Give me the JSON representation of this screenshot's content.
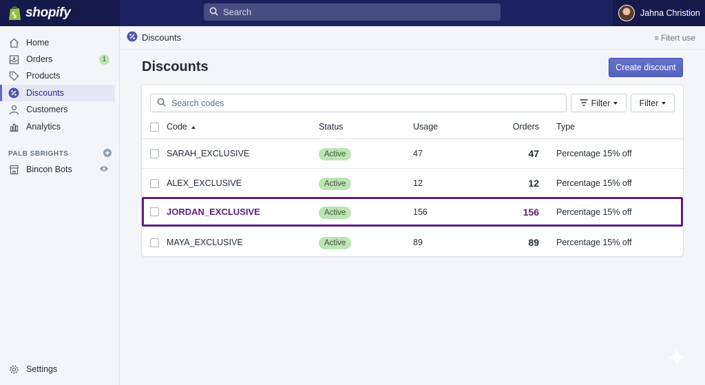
{
  "brand": {
    "name": "shopify"
  },
  "topbar": {
    "search_placeholder": "Search",
    "user_name": "Jahna Christion"
  },
  "sidebar": {
    "items": [
      {
        "label": "Home",
        "icon": "home-icon"
      },
      {
        "label": "Orders",
        "icon": "orders-icon",
        "badge": "1"
      },
      {
        "label": "Products",
        "icon": "tag-icon"
      },
      {
        "label": "Discounts",
        "icon": "discount-icon",
        "active": true
      },
      {
        "label": "Customers",
        "icon": "person-icon"
      },
      {
        "label": "Analytics",
        "icon": "chart-icon"
      }
    ],
    "section_title": "PALB SBRIGHTS",
    "channel": {
      "label": "Bincon Bots",
      "icon": "store-icon"
    },
    "settings_label": "Settings"
  },
  "page_head": {
    "title": "Discounts",
    "filter_user": "Fitert use"
  },
  "main": {
    "title": "Discounts",
    "create_button": "Create discount",
    "search_placeholder": "Search codes",
    "filter1_label": "Filter",
    "filter2_label": "Filter",
    "columns": {
      "code": "Code",
      "status": "Status",
      "usage": "Usage",
      "orders": "Orders",
      "type": "Type"
    },
    "rows": [
      {
        "code": "SARAH_EXCLUSIVE",
        "status": "Active",
        "usage": "47",
        "orders": "47",
        "type": "Percentage 15% off"
      },
      {
        "code": "ALEX_EXCLUSIVE",
        "status": "Active",
        "usage": "12",
        "orders": "12",
        "type": "Percentage 15% off"
      },
      {
        "code": "JORDAN_EXCLUSIVE",
        "status": "Active",
        "usage": "156",
        "orders": "156",
        "type": "Percentage 15% off"
      },
      {
        "code": "MAYA_EXCLUSIVE",
        "status": "Active",
        "usage": "89",
        "orders": "89",
        "type": "Percentage 15% off"
      }
    ]
  },
  "colors": {
    "topbar": "#1c2260",
    "accent": "#5c6ac4",
    "highlight": "#5b1e80",
    "badge": "#bbe5b3"
  }
}
